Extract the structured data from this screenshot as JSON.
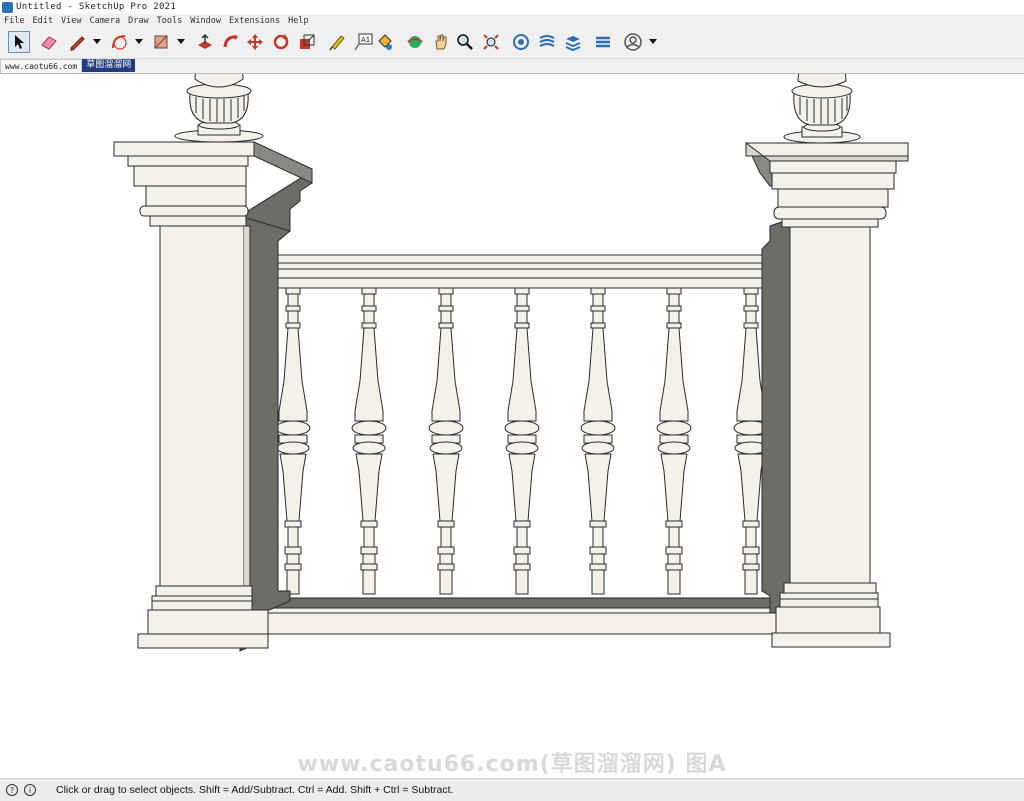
{
  "window": {
    "title": "Untitled - SketchUp Pro 2021"
  },
  "menu": [
    "File",
    "Edit",
    "View",
    "Camera",
    "Draw",
    "Tools",
    "Window",
    "Extensions",
    "Help"
  ],
  "toolbar": {
    "tools": [
      {
        "name": "select-icon"
      },
      {
        "name": "eraser-icon"
      },
      {
        "name": "pencil-line-icon"
      },
      {
        "name": "arc-icon"
      },
      {
        "name": "rectangle-icon"
      },
      {
        "name": "push-pull-icon"
      },
      {
        "name": "follow-me-icon"
      },
      {
        "name": "move-icon"
      },
      {
        "name": "rotate-icon"
      },
      {
        "name": "scale-icon"
      },
      {
        "name": "tape-measure-icon"
      },
      {
        "name": "text-icon"
      },
      {
        "name": "paint-bucket-icon"
      },
      {
        "name": "orbit-icon"
      },
      {
        "name": "pan-icon"
      },
      {
        "name": "zoom-icon"
      },
      {
        "name": "zoom-extents-icon"
      },
      {
        "name": "3d-warehouse-icon"
      },
      {
        "name": "extension-warehouse-icon"
      },
      {
        "name": "layout-icon"
      },
      {
        "name": "extension-manager-icon"
      },
      {
        "name": "account-icon"
      }
    ],
    "text_tool_label": "A1"
  },
  "tabs": {
    "tab1": "www.caotu66.com",
    "tab2": "草图溜溜网"
  },
  "watermark": "www.caotu66.com(草图溜溜网) 图A",
  "status": {
    "text": "Click or drag to select objects. Shift = Add/Subtract. Ctrl = Add. Shift + Ctrl = Subtract."
  },
  "colors": {
    "accent": "#2d6fb5",
    "tab_active": "#233b7e",
    "shadow": "#6e6c67",
    "model_fill": "#f3f1ea"
  }
}
